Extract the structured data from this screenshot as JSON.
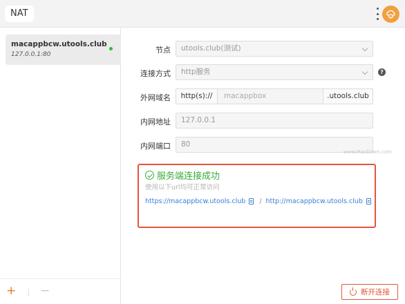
{
  "header": {
    "title": "NAT"
  },
  "sidebar": {
    "tunnels": [
      {
        "name": "macappbcw.utools.club",
        "address": "127.0.0.1:80",
        "status": "connected"
      }
    ],
    "add_label": "+",
    "remove_label": "−"
  },
  "form": {
    "node_label": "节点",
    "node_value": "utools.club(测试)",
    "connection_label": "连接方式",
    "connection_value": "http服务",
    "help_glyph": "?",
    "domain_label": "外网域名",
    "domain_prefix": "http(s)://",
    "domain_subdomain": "macappbox",
    "domain_suffix": ".utools.club",
    "local_address_label": "内网地址",
    "local_address_value": "127.0.0.1",
    "local_port_label": "内网端口",
    "local_port_value": "80"
  },
  "result": {
    "title": "服务端连接成功",
    "hint": "使用以下url均可正常访问",
    "https_url": "https://macappbcw.utools.club",
    "http_url": "http://macappbcw.utools.club",
    "separator": "/"
  },
  "footer": {
    "disconnect_label": "断开连接"
  },
  "watermark": "www.MacDown.com",
  "colors": {
    "accent_orange": "#e07b2a",
    "success_green": "#3aaa3a",
    "link_blue": "#3a7fd5",
    "danger_red": "#e0563a"
  }
}
